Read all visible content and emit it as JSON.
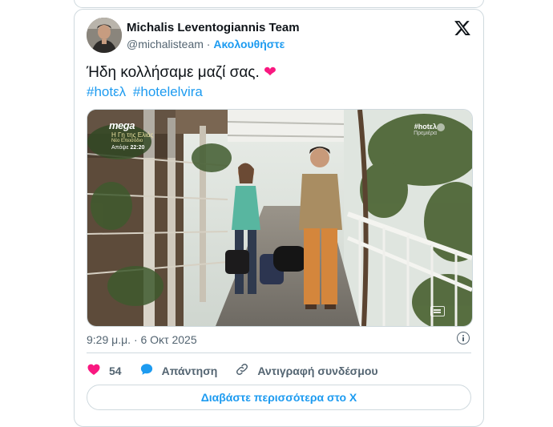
{
  "author": {
    "name": "Michalis Leventogiannis Team",
    "handle": "@michalisteam",
    "separator": "·",
    "follow_label": "Ακολουθήστε"
  },
  "tweet": {
    "text": "Ήδη κολλήσαμε μαζί σας.",
    "emoji": "❤",
    "hashtags": [
      "#hotελ",
      "#hotelelvira"
    ]
  },
  "media": {
    "channel_logo": "mega",
    "show_title": "Η Γη της Ελιάς",
    "show_note": "Νέο Επεισόδιο",
    "airtime_label": "Απόψε",
    "airtime": "22:20",
    "corner_tag": "#hotελ",
    "corner_sub": "Πρεμιέρα"
  },
  "timestamp": "9:29 μ.μ. · 6 Οκτ 2025",
  "actions": {
    "like_count": "54",
    "reply_label": "Απάντηση",
    "copy_link_label": "Αντιγραφή συνδέσμου"
  },
  "read_more_label": "Διαβάστε περισσότερα στο X",
  "colors": {
    "accent": "#1d9bf0",
    "like": "#f91880",
    "text": "#0f1419",
    "muted": "#536471",
    "border": "#cfd9de"
  },
  "icons": [
    "x-logo-icon",
    "info-icon",
    "heart-icon",
    "reply-bubble-icon",
    "link-icon",
    "closed-captions-icon"
  ]
}
